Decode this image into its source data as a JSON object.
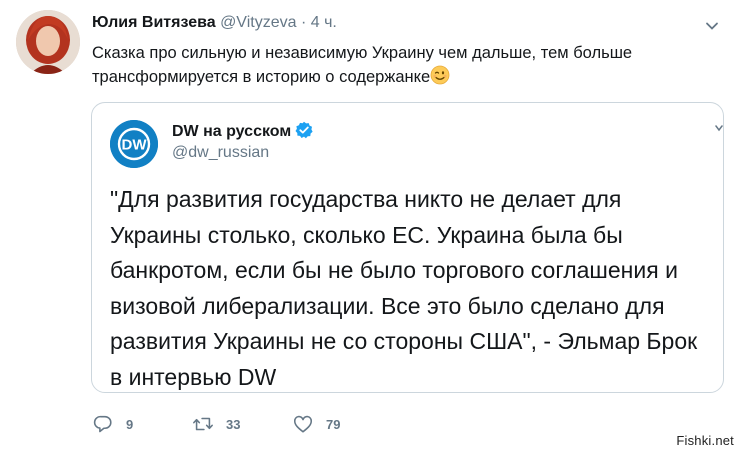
{
  "author": {
    "name": "Юлия Витязева",
    "handle": "@Vityzeva",
    "dot": "·",
    "time": "4 ч."
  },
  "tweet": {
    "text": "Сказка про сильную и независимую Украину чем дальше, тем больше трансформируется в историю о содержанке",
    "emoji": "winking-face-icon"
  },
  "quoted": {
    "name": "DW на русском",
    "handle": "@dw_russian",
    "logo_text": "DW",
    "text": "\"Для развития государства никто не делает для Украины столько, сколько ЕС. Украина была бы банкротом, если бы не было торгового соглашения и визовой либерализации. Все это было сделано для развития Украины не со стороны США\", - Эльмар Брок в интервью DW"
  },
  "actions": {
    "replies": "9",
    "retweets": "33",
    "likes": "79"
  },
  "watermark": "Fishki.net",
  "colors": {
    "text": "#14171a",
    "secondary": "#657786",
    "border": "#ccd6dd",
    "verified": "#1da1f2",
    "dw_blue": "#1180c4"
  }
}
